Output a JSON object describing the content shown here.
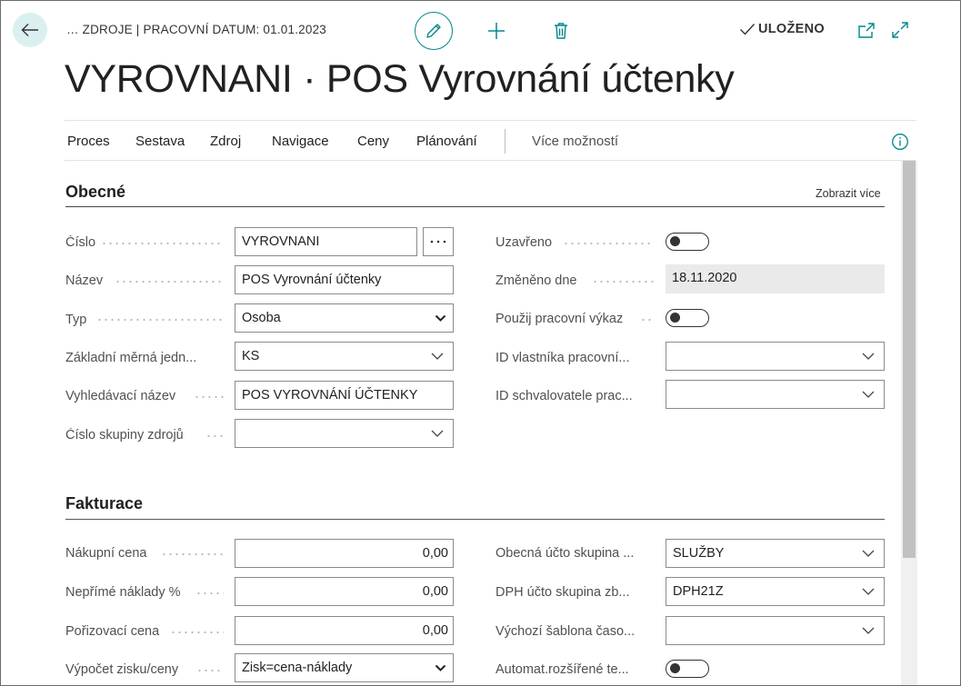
{
  "header": {
    "breadcrumb": "… ZDROJE | PRACOVNÍ DATUM: 01.01.2023",
    "saved_label": "ULOŽENO",
    "title": "VYROVNANI · POS Vyrovnání účtenky"
  },
  "actions": {
    "items": [
      "Proces",
      "Sestava",
      "Zdroj",
      "Navigace",
      "Ceny",
      "Plánování"
    ],
    "more": "Více možností"
  },
  "general": {
    "title": "Obecné",
    "show_more": "Zobrazit více",
    "left": [
      {
        "label": "Číslo",
        "value": "VYROVNANI"
      },
      {
        "label": "Název",
        "value": "POS Vyrovnání účtenky"
      },
      {
        "label": "Typ",
        "value": "Osoba"
      },
      {
        "label": "Základní měrná jedn...",
        "value": "KS"
      },
      {
        "label": "Vyhledávací název",
        "value": "POS VYROVNÁNÍ ÚČTENKY"
      },
      {
        "label": "Číslo skupiny zdrojů",
        "value": ""
      }
    ],
    "right": [
      {
        "label": "Uzavřeno",
        "value": false
      },
      {
        "label": "Změněno dne",
        "value": "18.11.2020"
      },
      {
        "label": "Použij pracovní výkaz",
        "value": false
      },
      {
        "label": "ID vlastníka pracovní...",
        "value": ""
      },
      {
        "label": "ID schvalovatele prac...",
        "value": ""
      }
    ]
  },
  "invoicing": {
    "title": "Fakturace",
    "left": [
      {
        "label": "Nákupní cena",
        "value": "0,00"
      },
      {
        "label": "Nepřímé náklady %",
        "value": "0,00"
      },
      {
        "label": "Pořizovací cena",
        "value": "0,00"
      },
      {
        "label": "Výpočet zisku/ceny",
        "value": "Zisk=cena-náklady"
      }
    ],
    "right": [
      {
        "label": "Obecná účto skupina ...",
        "value": "SLUŽBY"
      },
      {
        "label": "DPH účto skupina zb...",
        "value": "DPH21Z"
      },
      {
        "label": "Výchozí šablona časo...",
        "value": ""
      },
      {
        "label": "Automat.rozšířené te...",
        "value": false
      }
    ]
  },
  "colors": {
    "accent": "#00878a",
    "readonly_bg": "#eaeaea"
  }
}
